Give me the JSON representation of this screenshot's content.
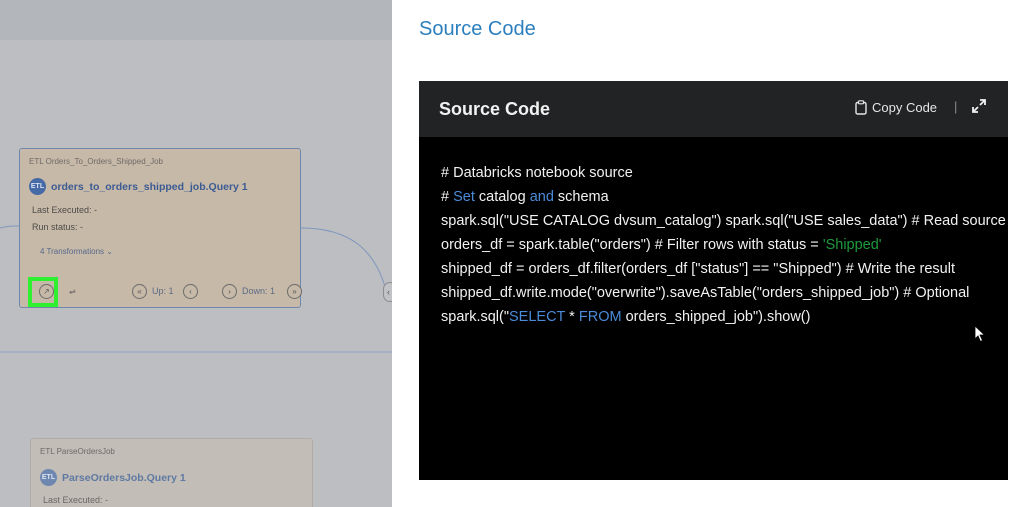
{
  "canvas": {
    "node1": {
      "type_label": "ETL  Orders_To_Orders_Shipped_Job",
      "badge": "ETL",
      "title": "orders_to_orders_shipped_job.Query 1",
      "last_executed": "Last Executed: -",
      "run_status": "Run status: -",
      "transformations": "4 Transformations ⌄",
      "up_label": "Up: 1",
      "down_label": "Down: 1"
    },
    "node2": {
      "type_label": "ETL  ParseOrdersJob",
      "badge": "ETL",
      "title": "ParseOrdersJob.Query 1",
      "last_executed": "Last Executed: -"
    }
  },
  "panel": {
    "title": "Source Code",
    "card_title": "Source Code",
    "copy_label": "Copy Code",
    "separator": "|"
  },
  "code": {
    "line1": "# Databricks notebook source",
    "line2_a": "# ",
    "line2_kw1": "Set",
    "line2_b": " catalog ",
    "line2_kw2": "and",
    "line2_c": " schema",
    "line3": "spark.sql(\"USE CATALOG dvsum_catalog\") spark.sql(\"USE sales_data\") # Read source",
    "line4_a": "orders_df = spark.table(\"orders\") # Filter rows with status = ",
    "line4_str": "'Shipped'",
    "line5": "shipped_df = orders_df.filter(orders_df [\"status\"] == \"Shipped\") # Write the result",
    "line6": "shipped_df.write.mode(\"overwrite\").saveAsTable(\"orders_shipped_job\") # Optional",
    "line7_a": "spark.sql(\"",
    "line7_kw1": "SELECT",
    "line7_b": " * ",
    "line7_kw2": "FROM",
    "line7_c": " orders_shipped_job\").show()"
  },
  "colors": {
    "title_blue": "#2c7fbf",
    "keyword_blue": "#4a8bd9",
    "string_green": "#1f9a3c",
    "highlight_green": "#2ff02f"
  }
}
